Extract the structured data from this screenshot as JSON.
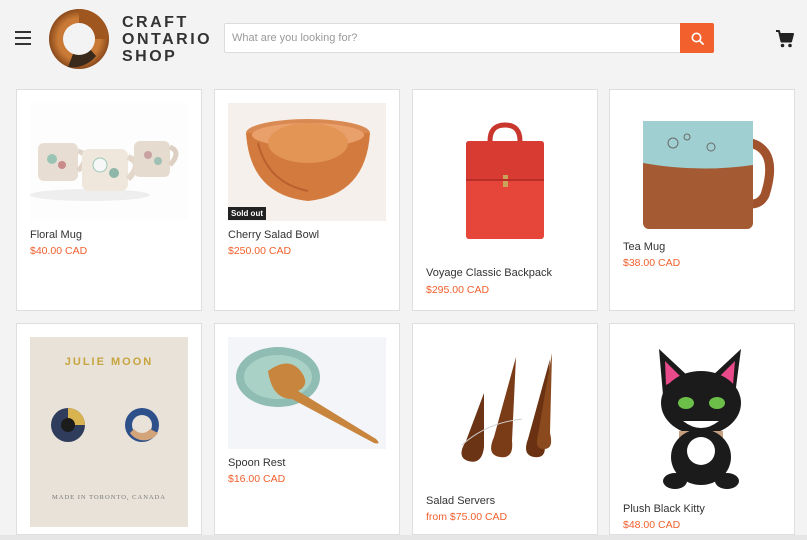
{
  "brand": {
    "line1": "CRAFT",
    "line2": "ONTARIO",
    "line3": "SHOP"
  },
  "search": {
    "placeholder": "What are you looking for?"
  },
  "icons": {
    "menu": "hamburger-icon",
    "search": "search-icon",
    "cart": "cart-icon"
  },
  "colors": {
    "accent": "#f1602d",
    "price": "#f1602d",
    "badge": "#222222"
  },
  "products": [
    {
      "title": "Floral Mug",
      "price": "$40.00 CAD",
      "badge": ""
    },
    {
      "title": "Cherry Salad Bowl",
      "price": "$250.00 CAD",
      "badge": "Sold out"
    },
    {
      "title": "Voyage Classic Backpack",
      "price": "$295.00 CAD",
      "badge": ""
    },
    {
      "title": "Tea Mug",
      "price": "$38.00 CAD",
      "badge": ""
    },
    {
      "title": "",
      "price": "",
      "badge": "",
      "image_text": [
        "JULIE MOON",
        "MADE IN TORONTO, CANADA"
      ]
    },
    {
      "title": "Spoon Rest",
      "price": "$16.00 CAD",
      "badge": ""
    },
    {
      "title": "Salad Servers",
      "price": "from $75.00 CAD",
      "badge": ""
    },
    {
      "title": "Plush Black Kitty",
      "price": "$48.00 CAD",
      "badge": ""
    }
  ]
}
